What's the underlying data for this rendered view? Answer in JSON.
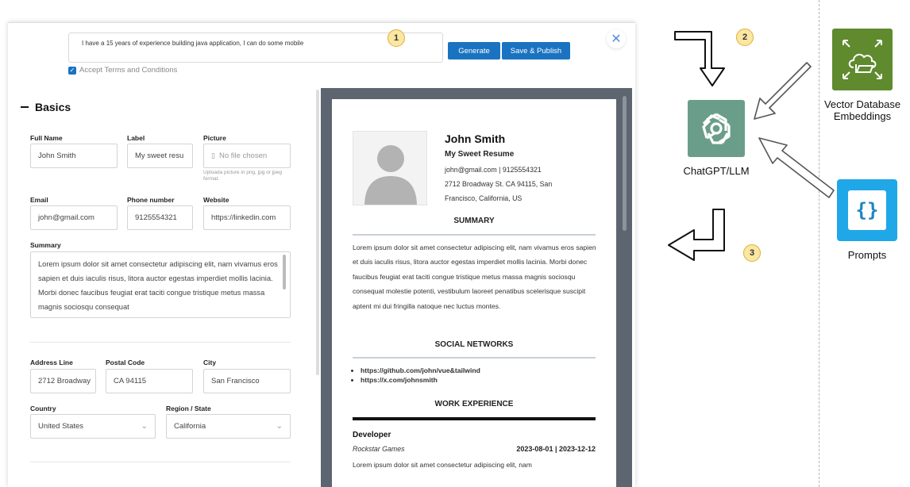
{
  "app": {
    "prompt_text": "I have a 15 years of  experience building java application, I can do some mobile",
    "generate_label": "Generate",
    "publish_label": "Save & Publish",
    "close_glyph": "✕",
    "terms_label": "Accept Terms and Conditions",
    "terms_checked": true
  },
  "form": {
    "section_title": "Basics",
    "full_name": {
      "label": "Full Name",
      "value": "John Smith"
    },
    "label_field": {
      "label": "Label",
      "value": "My sweet resu"
    },
    "picture": {
      "label": "Picture",
      "value": "No file chosen",
      "hint": "Uploada picture in png, jpg or jpeg format."
    },
    "email": {
      "label": "Email",
      "value": "john@gmail.com"
    },
    "phone": {
      "label": "Phone number",
      "value": "9125554321"
    },
    "website": {
      "label": "Website",
      "value": "https://linkedin.com"
    },
    "summary": {
      "label": "Summary",
      "value": "Lorem ipsum dolor sit amet consectetur adipiscing elit, nam vivamus eros sapien et duis iaculis risus, litora auctor egestas imperdiet mollis lacinia. Morbi donec faucibus feugiat erat taciti congue tristique metus massa magnis sociosqu consequat"
    },
    "address": {
      "label": "Address Line",
      "value": "2712 Broadway"
    },
    "postal": {
      "label": "Postal Code",
      "value": "CA 94115"
    },
    "city": {
      "label": "City",
      "value": "San Francisco"
    },
    "country": {
      "label": "Country",
      "value": "United States"
    },
    "region": {
      "label": "Region / State",
      "value": "California"
    }
  },
  "resume": {
    "name": "John Smith",
    "label": "My Sweet Resume",
    "contact_line": "john@gmail.com   |   9125554321",
    "address_line1": "2712 Broadway St. CA 94115, San",
    "address_line2": "Francisco, California, US",
    "summary_heading": "SUMMARY",
    "summary_text": "Lorem ipsum dolor sit amet consectetur adipiscing elit, nam vivamus eros sapien et duis iaculis risus, litora auctor egestas imperdiet mollis lacinia. Morbi donec faucibus feugiat erat taciti congue tristique metus massa magnis sociosqu consequat molestie potenti, vestibulum laoreet penatibus scelerisque suscipit aptent mi dui fringilla natoque nec luctus montes.",
    "social_heading": "SOCIAL NETWORKS",
    "social_links": [
      "https://github.com/john/vue&tailwind",
      "https://x.com/johnsmith"
    ],
    "work_heading": "WORK EXPERIENCE",
    "role": "Developer",
    "company": "Rockstar Games",
    "dates": "2023-08-01  |  2023-12-12",
    "work_text": "Lorem ipsum dolor sit amet consectetur adipiscing elit, nam"
  },
  "diagram": {
    "step1": "1",
    "step2": "2",
    "step3": "3",
    "llm_label": "ChatGPT/LLM",
    "vector_label_line1": "Vector Database",
    "vector_label_line2": "Embeddings",
    "prompts_label": "Prompts",
    "prompts_glyph": "{}",
    "colors": {
      "llm": "#6a9e8a",
      "vector": "#5f8a2e",
      "prompts": "#20a7e8",
      "badge": "#fbe6a2"
    }
  }
}
